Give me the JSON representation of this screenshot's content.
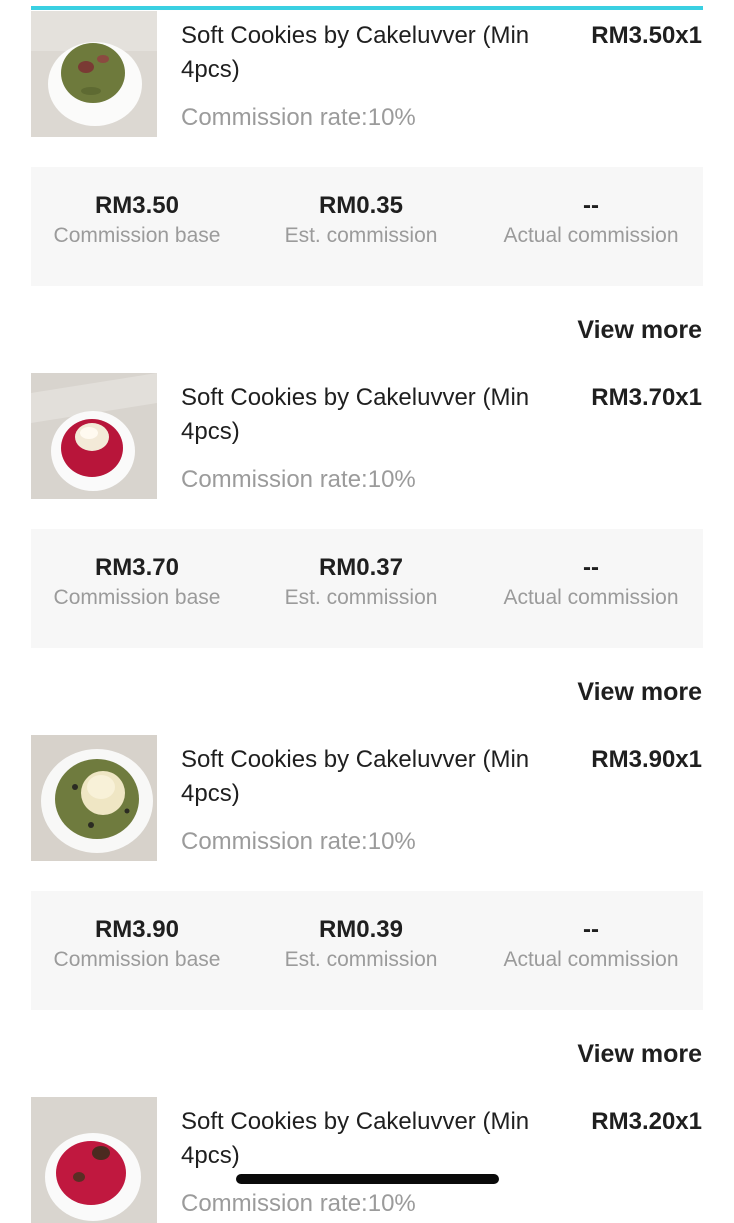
{
  "items": [
    {
      "title": "Soft Cookies by Cakeluvver (Min 4pcs)",
      "price": "RM3.50x1",
      "commission_rate": "Commission rate:10%",
      "image": "pandan-cookie-icon",
      "stats": [
        {
          "value": "RM3.50",
          "label": "Commission base"
        },
        {
          "value": "RM0.35",
          "label": "Est. commission"
        },
        {
          "value": "--",
          "label": "Actual commission"
        }
      ],
      "view_more": "View more"
    },
    {
      "title": "Soft Cookies by Cakeluvver (Min 4pcs)",
      "price": "RM3.70x1",
      "commission_rate": "Commission rate:10%",
      "image": "red-velvet-cookie-icon",
      "stats": [
        {
          "value": "RM3.70",
          "label": "Commission base"
        },
        {
          "value": "RM0.37",
          "label": "Est. commission"
        },
        {
          "value": "--",
          "label": "Actual commission"
        }
      ],
      "view_more": "View more"
    },
    {
      "title": "Soft Cookies by Cakeluvver (Min 4pcs)",
      "price": "RM3.90x1",
      "commission_rate": "Commission rate:10%",
      "image": "matcha-cream-cookie-icon",
      "stats": [
        {
          "value": "RM3.90",
          "label": "Commission base"
        },
        {
          "value": "RM0.39",
          "label": "Est. commission"
        },
        {
          "value": "--",
          "label": "Actual commission"
        }
      ],
      "view_more": "View more"
    },
    {
      "title": "Soft Cookies by Cakeluvver (Min 4pcs)",
      "price": "RM3.20x1",
      "commission_rate": "Commission rate:10%",
      "image": "red-velvet-choc-cookie-icon",
      "stats": [
        {
          "value": "",
          "label": ""
        },
        {
          "value": "",
          "label": ""
        },
        {
          "value": "",
          "label": ""
        }
      ],
      "view_more": ""
    }
  ],
  "colors": {
    "accent": "#3ad0e2",
    "muted_text": "#9b9b9b",
    "panel_bg": "#f7f7f7"
  }
}
